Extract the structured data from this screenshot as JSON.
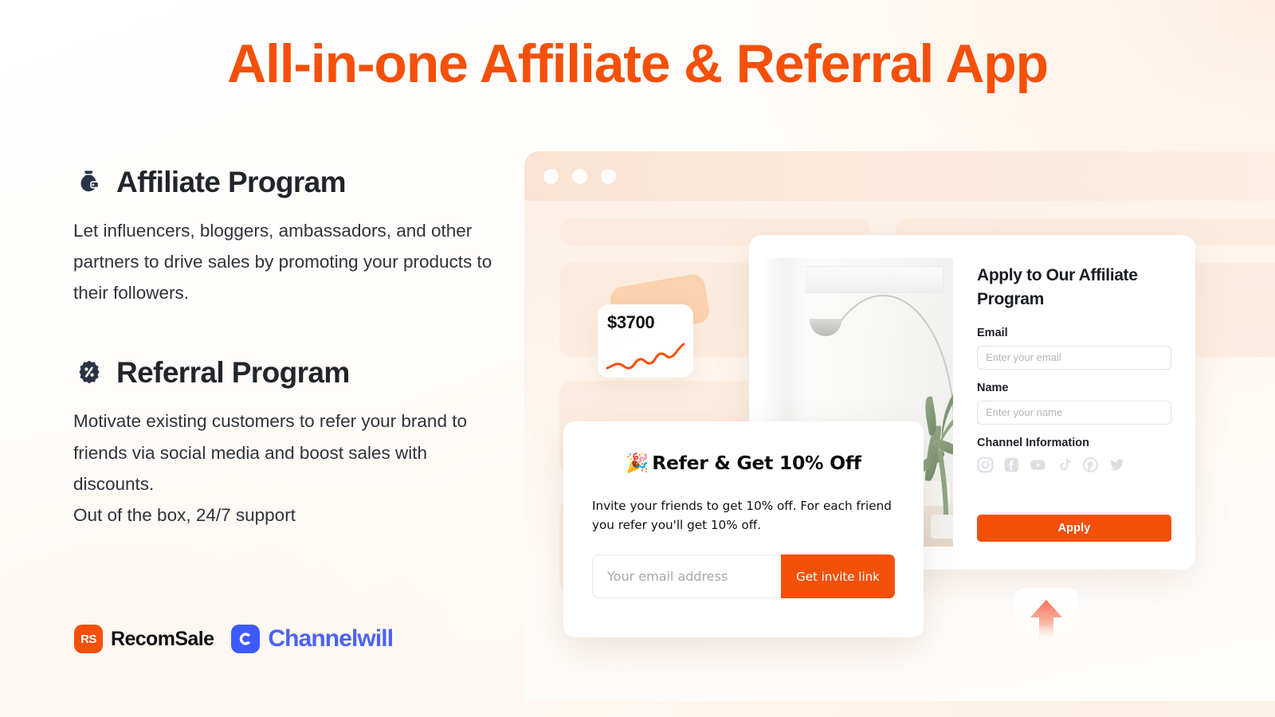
{
  "headline": "All-in-one Affiliate & Referral App",
  "brand": {
    "accent_orange": "#f4500a",
    "dark_navy": "#2b3445",
    "channelwill_blue": "#4a63f5"
  },
  "features": [
    {
      "icon": "money-bag-icon",
      "title": "Affiliate Program",
      "body": "Let influencers, bloggers, ambassadors, and other partners to drive sales by promoting your products to their followers."
    },
    {
      "icon": "discount-badge-icon",
      "title": "Referral Program",
      "body": "Motivate existing customers to refer your brand to friends via social media and boost sales with discounts.\nOut of the box, 24/7 support"
    }
  ],
  "logos": [
    {
      "mark_text": "RS",
      "name": "RecomSale"
    },
    {
      "mark_text": "C",
      "name": "Channelwill"
    }
  ],
  "browser": {
    "dots": [
      "red-dot",
      "yellow-dot",
      "green-dot"
    ]
  },
  "stat_card": {
    "value": "$3700",
    "icon": "trend-line-icon"
  },
  "apply_form": {
    "title": "Apply to Our Affiliate Program",
    "email_label": "Email",
    "email_placeholder": "Enter your email",
    "name_label": "Name",
    "name_placeholder": "Enter your name",
    "channel_label": "Channel Information",
    "socials": [
      "instagram-icon",
      "facebook-icon",
      "youtube-icon",
      "tiktok-icon",
      "pinterest-icon",
      "twitter-icon"
    ],
    "submit_label": "Apply"
  },
  "refer_card": {
    "emoji": "🎉",
    "title": "Refer & Get 10% Off",
    "description": "Invite your friends to get 10% off. For each friend you refer you'll get 10% off.",
    "email_placeholder": "Your email address",
    "submit_label": "Get invite link"
  },
  "arrow_card": {
    "icon": "up-arrow-icon"
  }
}
